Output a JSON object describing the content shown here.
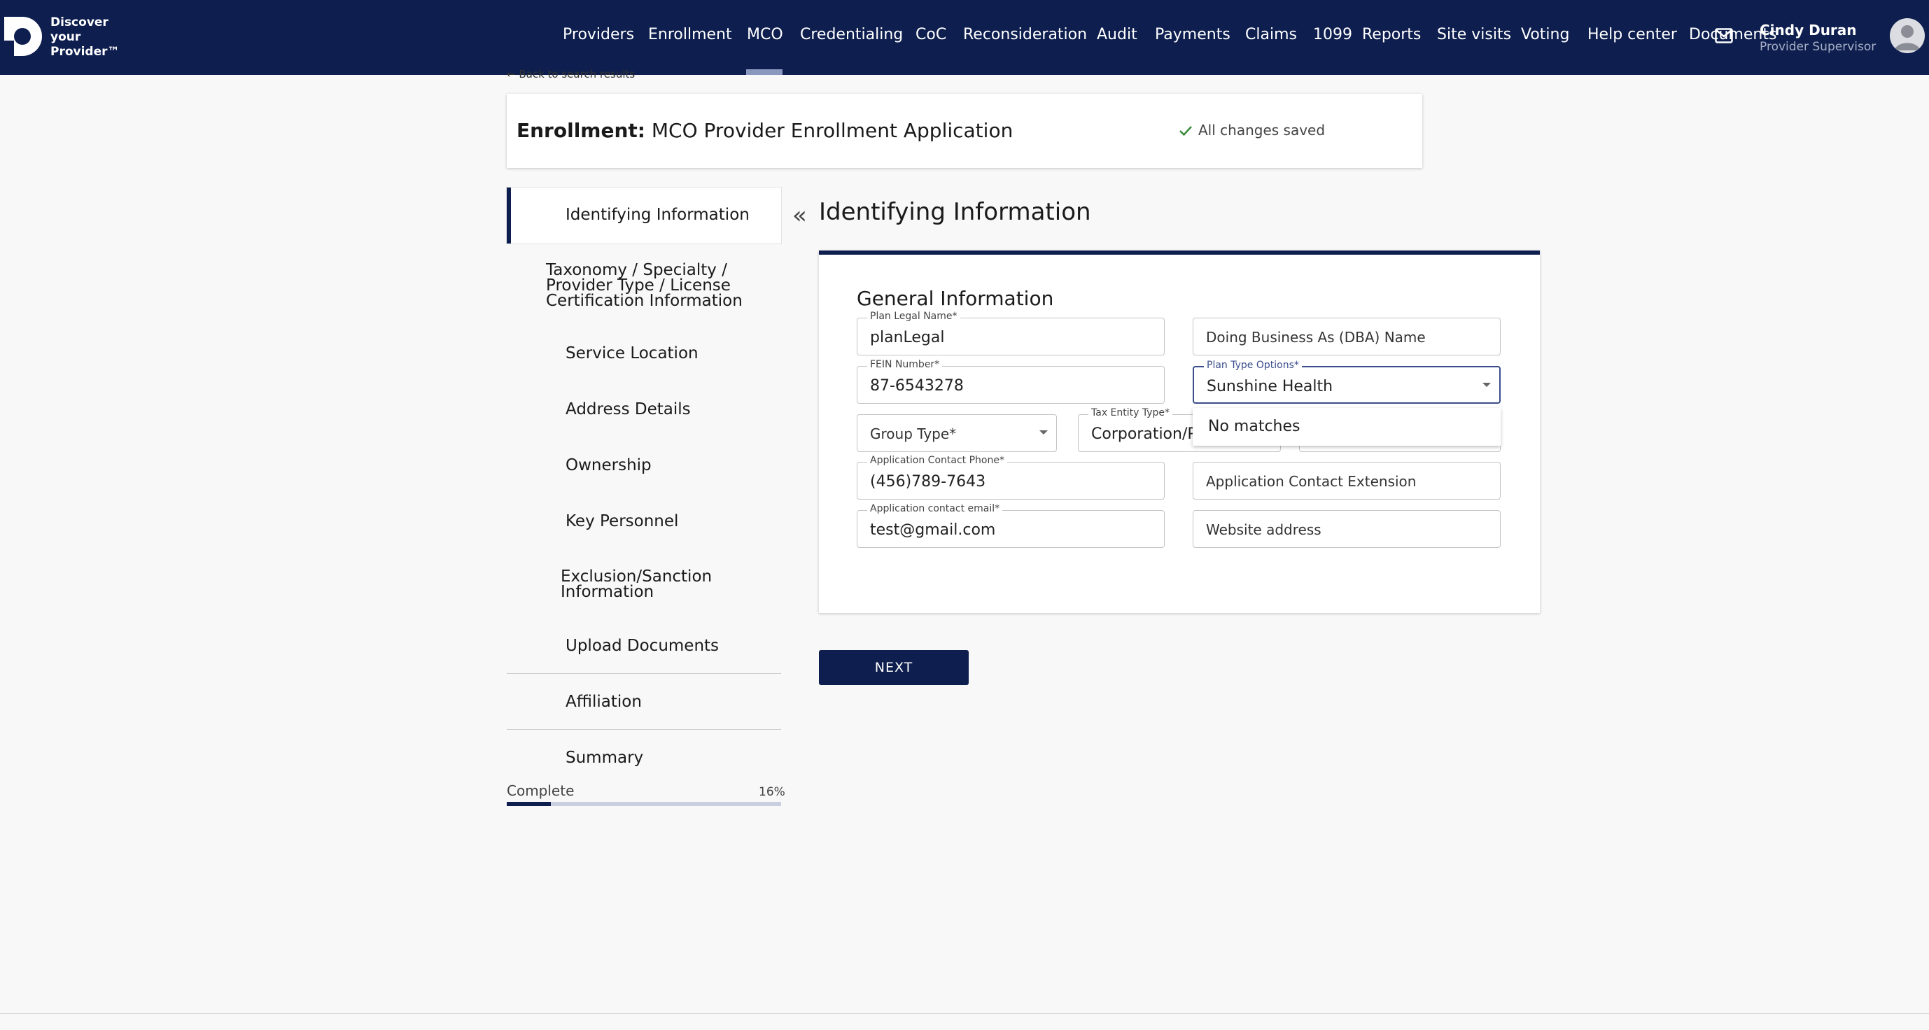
{
  "brand": {
    "line1": "Discover",
    "line2": "your",
    "line3": "Provider™"
  },
  "nav": {
    "items": [
      "Providers",
      "Enrollment",
      "MCO",
      "Credentialing",
      "CoC",
      "Reconsideration",
      "Audit",
      "Payments",
      "Claims",
      "1099",
      "Reports",
      "Site visits",
      "Voting",
      "Help center",
      "Documents"
    ],
    "active": "MCO"
  },
  "user": {
    "name": "Cindy Duran",
    "role": "Provider Supervisor"
  },
  "back_link": "← Back to search results",
  "header": {
    "prefix": "Enrollment:",
    "title": "MCO Provider Enrollment Application",
    "status": "All changes saved"
  },
  "sidebar": {
    "items": [
      {
        "label": "Identifying Information"
      },
      {
        "line1": "Taxonomy / Specialty /",
        "line2": "Provider Type / License",
        "line3": "Certification Information"
      },
      {
        "label": "Service Location"
      },
      {
        "label": "Address Details"
      },
      {
        "label": "Ownership"
      },
      {
        "label": "Key Personnel"
      },
      {
        "line1": "Exclusion/Sanction",
        "line2": "Information"
      },
      {
        "label": "Upload Documents"
      },
      {
        "label": "Affiliation"
      },
      {
        "label": "Summary"
      }
    ],
    "complete_label": "Complete",
    "complete_pct": "16%",
    "progress_fraction": 0.16
  },
  "main": {
    "title": "Identifying Information",
    "section": "General Information",
    "fields": {
      "plan_legal_name": {
        "label": "Plan Legal Name*",
        "value": "planLegal"
      },
      "dba_name": {
        "placeholder": "Doing Business As (DBA) Name"
      },
      "fein": {
        "label": "FEIN Number*",
        "value": "87-6543278"
      },
      "plan_type": {
        "label": "Plan Type Options*",
        "value": "Sunshine Health"
      },
      "group_type": {
        "placeholder": "Group Type*"
      },
      "tax_entity": {
        "label": "Tax Entity Type*",
        "value": "Corporation/P"
      },
      "contact_phone": {
        "label": "Application Contact Phone*",
        "value": "(456)789-7643"
      },
      "contact_ext": {
        "placeholder": "Application Contact Extension"
      },
      "contact_email": {
        "label": "Application contact email*",
        "value": "test@gmail.com"
      },
      "website": {
        "placeholder": "Website address"
      }
    },
    "dropdown_message": "No matches",
    "next_label": "NEXT"
  },
  "colors": {
    "navy": "#0e1f4f",
    "focus": "#3a4d8c",
    "success": "#3a8a3a"
  }
}
